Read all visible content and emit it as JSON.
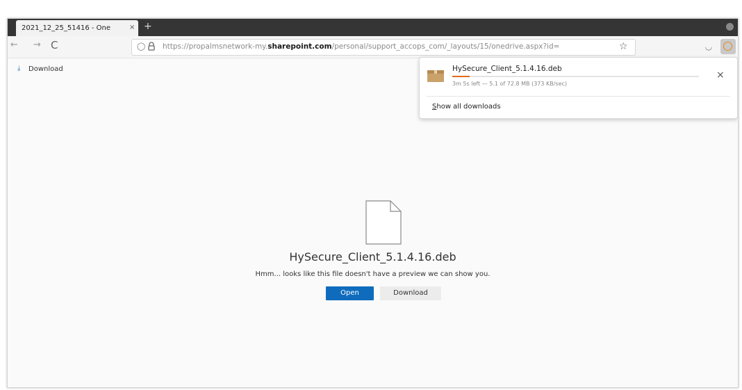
{
  "tab": {
    "title": "2021_12_25_51416 - One",
    "close": "×",
    "new_tab": "+"
  },
  "toolbar": {
    "back": "←",
    "forward": "→",
    "reload": "C",
    "url_prefix": "https://propalmsnetwork-my.",
    "url_domain": "sharepoint.com",
    "url_suffix": "/personal/support_accops_com/_layouts/15/onedrive.aspx?id=",
    "shield": "◯",
    "star": "☆",
    "pocket": "◡"
  },
  "page": {
    "download_link": "Download",
    "download_link_icon": "⤓",
    "file_name": "HySecure_Client_5.1.4.16.deb",
    "preview_message": "Hmm... looks like this file doesn't have a preview we can show you.",
    "open_label": "Open",
    "download_label": "Download"
  },
  "downloads_panel": {
    "filename": "HySecure_Client_5.1.4.16.deb",
    "status": "3m 5s left — 5.1 of 72.8 MB (373 KB/sec)",
    "progress_fraction": 0.07,
    "cancel": "×",
    "show_all_first": "S",
    "show_all_rest": "how all downloads"
  },
  "colors": {
    "accent": "#0f6cbd",
    "progress": "#e06a1b",
    "tabstrip": "#353535"
  }
}
